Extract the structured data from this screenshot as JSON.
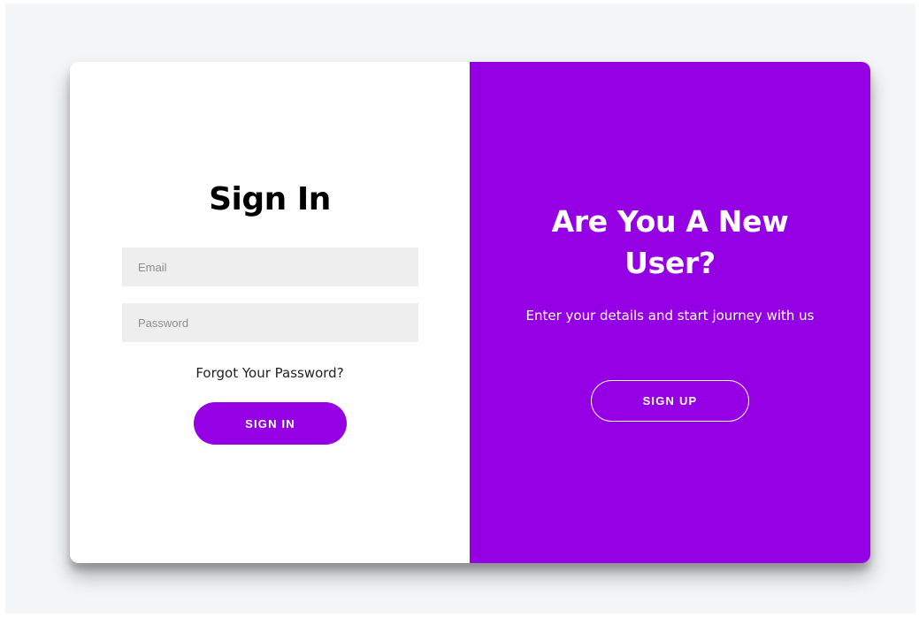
{
  "signin": {
    "title": "Sign In",
    "email_placeholder": "Email",
    "password_placeholder": "Password",
    "forgot_link": "Forgot Your Password?",
    "button_label": "SIGN IN"
  },
  "signup_panel": {
    "title": "Are You A New User?",
    "subtitle": "Enter your details and start journey with us",
    "button_label": "SIGN UP"
  },
  "colors": {
    "accent": "#9400e3",
    "page_background": "#f4f5f7",
    "input_background": "#eeeeee"
  }
}
